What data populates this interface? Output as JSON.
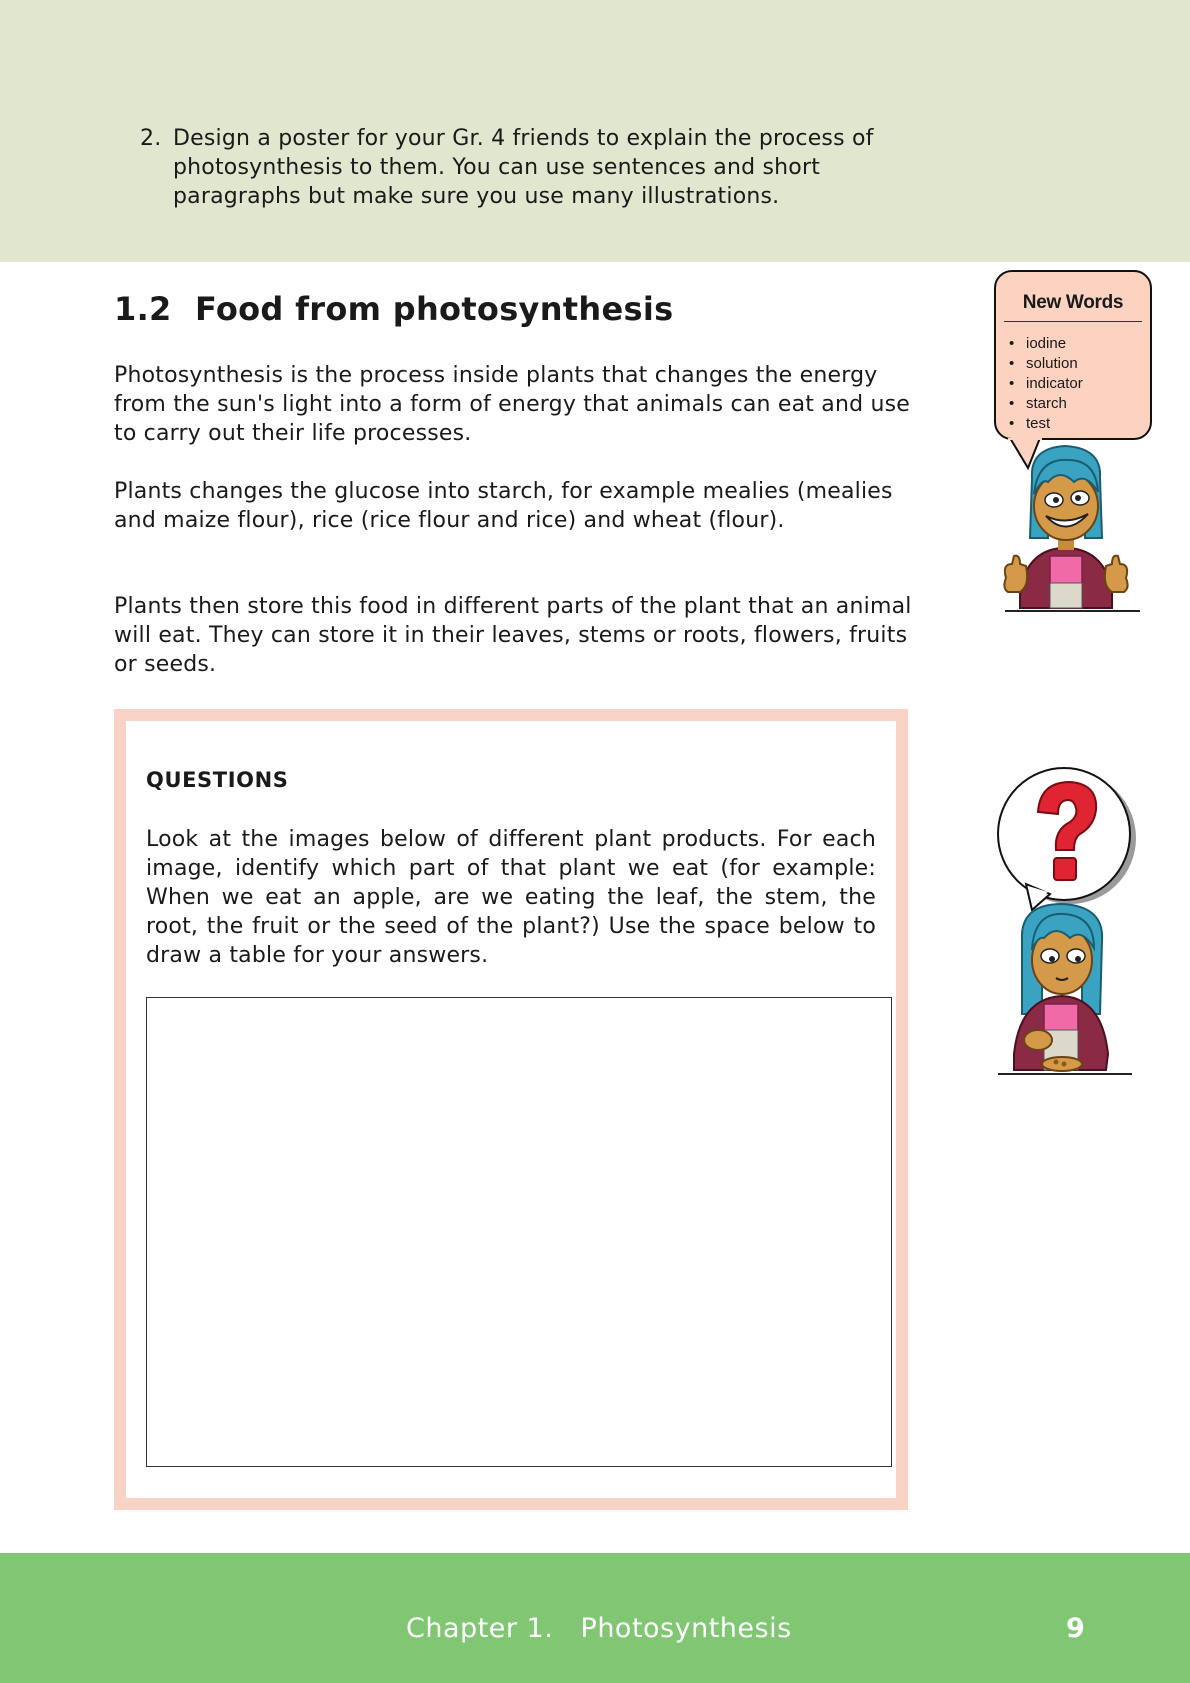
{
  "task": {
    "number": "2.",
    "text": "Design a poster for your Gr. 4 friends to explain the process of photosynthesis to them. You can use sentences and short paragraphs but make sure you use many illustrations."
  },
  "section": {
    "number": "1.2",
    "title": "Food from photosynthesis",
    "paragraphs": [
      "Photosynthesis is the process inside plants that changes the energy from the sun's light into a form of energy that animals can eat and use to carry out their life processes.",
      "Plants changes the glucose into starch, for example mealies (mealies and maize flour), rice (rice flour and rice) and wheat (flour).",
      "Plants then store this food in different parts of the plant that an animal will eat. They can store it in their leaves, stems or roots, flowers, fruits or seeds."
    ]
  },
  "questions": {
    "title": "QUESTIONS",
    "text": "Look at the images below of different plant products. For each image, identify which part of that plant we eat (for example: When we eat an apple, are we eating the leaf, the stem, the root, the fruit or the seed of the plant?) Use the space below to draw a table for your answers."
  },
  "new_words": {
    "title": "New Words",
    "items": [
      "iodine",
      "solution",
      "indicator",
      "starch",
      "test"
    ]
  },
  "footer": {
    "chapter": "Chapter 1.   Photosynthesis",
    "page_number": "9"
  },
  "colors": {
    "top_band": "#e1e6cf",
    "question_border": "#f9d4c6",
    "new_words_bg": "#fcd3c1",
    "footer_band": "#80c673"
  },
  "icons": {
    "character_thumbs_up": "girl-thumbs-up-icon",
    "character_question": "girl-question-mark-icon"
  }
}
